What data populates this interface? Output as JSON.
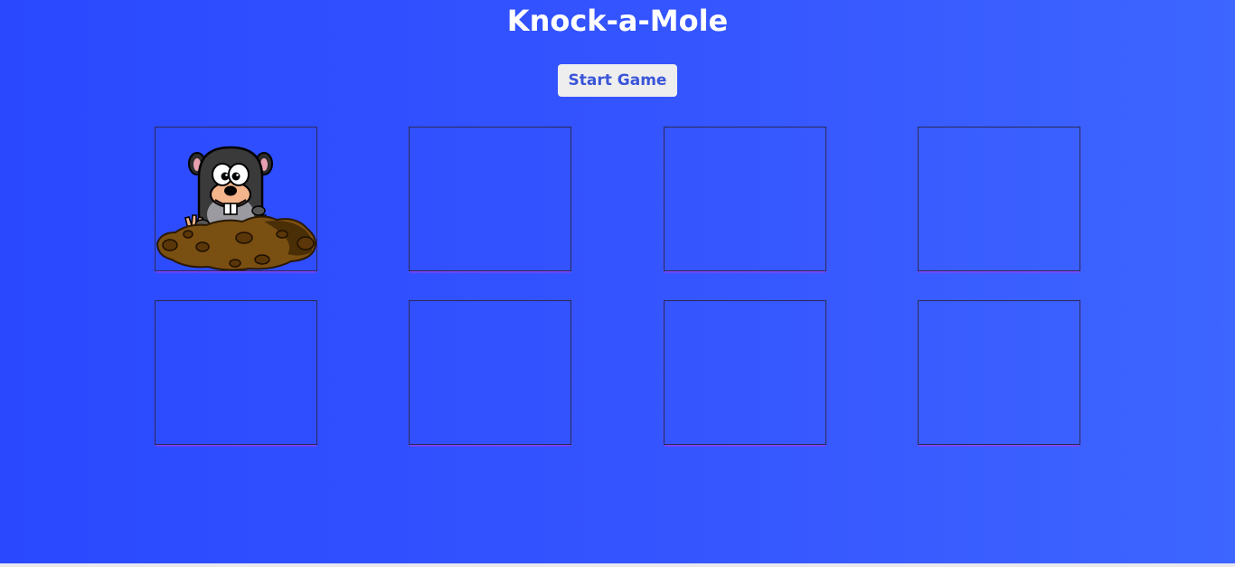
{
  "game": {
    "title": "Knock-a-Mole",
    "start_button_label": "Start Game"
  },
  "board": {
    "rows": 2,
    "columns": 4,
    "holes": [
      {
        "index": 1,
        "has_mole": true
      },
      {
        "index": 2,
        "has_mole": false
      },
      {
        "index": 3,
        "has_mole": false
      },
      {
        "index": 4,
        "has_mole": false
      },
      {
        "index": 5,
        "has_mole": false
      },
      {
        "index": 6,
        "has_mole": false
      },
      {
        "index": 7,
        "has_mole": false
      },
      {
        "index": 8,
        "has_mole": false
      }
    ]
  },
  "colors": {
    "background_start": "#2a49ff",
    "background_end": "#3d65ff",
    "title_color": "#ffffff",
    "button_bg": "#eeeeef",
    "button_text": "#3a55d8",
    "hole_border": "#2a2a55",
    "hole_glow": "#b23cff"
  },
  "icons": {
    "mole": "mole-icon"
  }
}
